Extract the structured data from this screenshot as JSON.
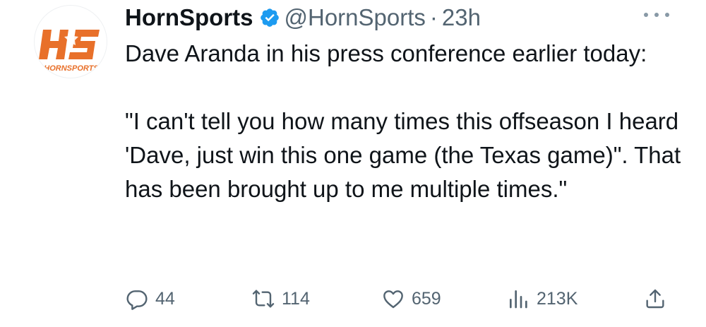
{
  "author": {
    "display_name": "HornSports",
    "handle": "@HornSports",
    "separator": "·",
    "time_ago": "23h",
    "avatar": {
      "monogram": "HS",
      "wordmark": "HORNSPORTS",
      "brand_color": "#e8702a"
    }
  },
  "tweet": {
    "paragraphs": [
      "Dave Aranda in his press conference earlier today:",
      "\"I can't tell you how many times this offseason I heard 'Dave, just win this one game (the Texas game)\". That has been brought up to me multiple times.\""
    ]
  },
  "actions": {
    "reply_count": "44",
    "repost_count": "114",
    "like_count": "659",
    "view_count": "213K"
  },
  "icons": {
    "verified": "verified-badge-icon",
    "more": "more-icon",
    "reply": "reply-icon",
    "repost": "repost-icon",
    "like": "like-icon",
    "views": "views-icon",
    "share": "share-icon"
  },
  "colors": {
    "text_primary": "#0f1419",
    "text_secondary": "#536471",
    "verified_blue": "#1d9bf0"
  }
}
